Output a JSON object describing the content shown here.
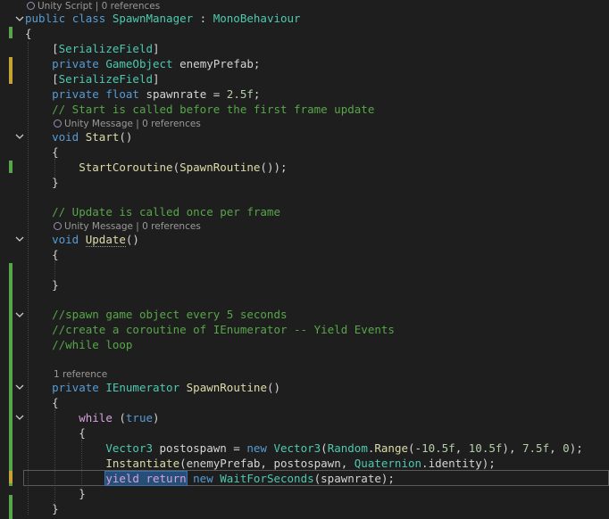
{
  "code_lens": {
    "class_line": "Unity Script | 0 references",
    "start_line": "Unity Message | 0 references",
    "update_line": "Unity Message | 0 references",
    "routine_line": "1 reference"
  },
  "lines": [
    [
      {
        "t": "public ",
        "c": "kw"
      },
      {
        "t": "class ",
        "c": "kw"
      },
      {
        "t": "SpawnManager",
        "c": "type"
      },
      {
        "t": " : ",
        "c": "id"
      },
      {
        "t": "MonoBehaviour",
        "c": "type"
      }
    ],
    [
      {
        "t": "{",
        "c": "id"
      }
    ],
    [
      {
        "t": "    ",
        "c": "id"
      },
      {
        "t": "[",
        "c": "id"
      },
      {
        "t": "SerializeField",
        "c": "attr"
      },
      {
        "t": "]",
        "c": "id"
      }
    ],
    [
      {
        "t": "    ",
        "c": "id"
      },
      {
        "t": "private ",
        "c": "kw"
      },
      {
        "t": "GameObject",
        "c": "type"
      },
      {
        "t": " enemyPrefab;",
        "c": "id"
      }
    ],
    [
      {
        "t": "    ",
        "c": "id"
      },
      {
        "t": "[",
        "c": "id"
      },
      {
        "t": "SerializeField",
        "c": "attr"
      },
      {
        "t": "]",
        "c": "id"
      }
    ],
    [
      {
        "t": "    ",
        "c": "id"
      },
      {
        "t": "private ",
        "c": "kw"
      },
      {
        "t": "float ",
        "c": "kw"
      },
      {
        "t": "spawnrate = ",
        "c": "id"
      },
      {
        "t": "2.5f",
        "c": "num"
      },
      {
        "t": ";",
        "c": "id"
      }
    ],
    [
      {
        "t": "    ",
        "c": "id"
      },
      {
        "t": "// Start is called before the first frame update",
        "c": "com"
      }
    ],
    [
      {
        "t": "    ",
        "c": "id"
      },
      {
        "t": "void ",
        "c": "kw"
      },
      {
        "t": "Start",
        "c": "fn"
      },
      {
        "t": "()",
        "c": "id"
      }
    ],
    [
      {
        "t": "    {",
        "c": "id"
      }
    ],
    [
      {
        "t": "        ",
        "c": "id"
      },
      {
        "t": "StartCoroutine",
        "c": "fn"
      },
      {
        "t": "(",
        "c": "id"
      },
      {
        "t": "SpawnRoutine",
        "c": "fn"
      },
      {
        "t": "());",
        "c": "id"
      }
    ],
    [
      {
        "t": "    }",
        "c": "id"
      }
    ],
    [],
    [
      {
        "t": "    ",
        "c": "id"
      },
      {
        "t": "// Update is called once per frame",
        "c": "com"
      }
    ],
    [
      {
        "t": "    ",
        "c": "id"
      },
      {
        "t": "void ",
        "c": "kw"
      },
      {
        "t": "Update",
        "c": "fn",
        "u": true
      },
      {
        "t": "()",
        "c": "id"
      }
    ],
    [
      {
        "t": "    {",
        "c": "id"
      }
    ],
    [],
    [
      {
        "t": "    }",
        "c": "id"
      }
    ],
    [],
    [
      {
        "t": "    ",
        "c": "id"
      },
      {
        "t": "//spawn game object every 5 seconds",
        "c": "com"
      }
    ],
    [
      {
        "t": "    ",
        "c": "id"
      },
      {
        "t": "//create a coroutine of IEnumerator -- Yield Events",
        "c": "com"
      }
    ],
    [
      {
        "t": "    ",
        "c": "id"
      },
      {
        "t": "//while loop",
        "c": "com"
      }
    ],
    [],
    [
      {
        "t": "    ",
        "c": "id"
      },
      {
        "t": "private ",
        "c": "kw"
      },
      {
        "t": "IEnumerator",
        "c": "type"
      },
      {
        "t": " ",
        "c": "id"
      },
      {
        "t": "SpawnRoutine",
        "c": "fn"
      },
      {
        "t": "()",
        "c": "id"
      }
    ],
    [
      {
        "t": "    {",
        "c": "id"
      }
    ],
    [
      {
        "t": "        ",
        "c": "id"
      },
      {
        "t": "while ",
        "c": "ctl"
      },
      {
        "t": "(",
        "c": "id"
      },
      {
        "t": "true",
        "c": "kw"
      },
      {
        "t": ")",
        "c": "id"
      }
    ],
    [
      {
        "t": "        {",
        "c": "id"
      }
    ],
    [
      {
        "t": "            ",
        "c": "id"
      },
      {
        "t": "Vector3",
        "c": "type"
      },
      {
        "t": " postospawn = ",
        "c": "id"
      },
      {
        "t": "new ",
        "c": "kw"
      },
      {
        "t": "Vector3",
        "c": "type"
      },
      {
        "t": "(",
        "c": "id"
      },
      {
        "t": "Random",
        "c": "type"
      },
      {
        "t": ".",
        "c": "id"
      },
      {
        "t": "Range",
        "c": "fn"
      },
      {
        "t": "(-",
        "c": "id"
      },
      {
        "t": "10.5f",
        "c": "num"
      },
      {
        "t": ", ",
        "c": "id"
      },
      {
        "t": "10.5f",
        "c": "num"
      },
      {
        "t": "), ",
        "c": "id"
      },
      {
        "t": "7.5f",
        "c": "num"
      },
      {
        "t": ", ",
        "c": "id"
      },
      {
        "t": "0",
        "c": "num"
      },
      {
        "t": ");",
        "c": "id"
      }
    ],
    [
      {
        "t": "            ",
        "c": "id"
      },
      {
        "t": "Instantiate",
        "c": "fn"
      },
      {
        "t": "(enemyPrefab, postospawn, ",
        "c": "id"
      },
      {
        "t": "Quaternion",
        "c": "type"
      },
      {
        "t": ".identity);",
        "c": "id"
      }
    ],
    [
      {
        "t": "            ",
        "c": "id"
      },
      {
        "t": "yield return",
        "c": "ctl",
        "sel": true
      },
      {
        "t": " ",
        "c": "id"
      },
      {
        "t": "new ",
        "c": "kw"
      },
      {
        "t": "WaitForSeconds",
        "c": "type"
      },
      {
        "t": "(spawnrate);",
        "c": "id"
      }
    ],
    [
      {
        "t": "        }",
        "c": "id"
      }
    ],
    [
      {
        "t": "    }",
        "c": "id"
      }
    ]
  ],
  "colors": {
    "background": "#1e1e1e",
    "keyword": "#569cd6",
    "control": "#d8a0df",
    "type": "#4ec9b0",
    "method": "#dcdcaa",
    "number": "#b5cea8",
    "comment": "#57a64a",
    "change_saved": "#57a64a",
    "change_unsaved": "#c5a332"
  }
}
